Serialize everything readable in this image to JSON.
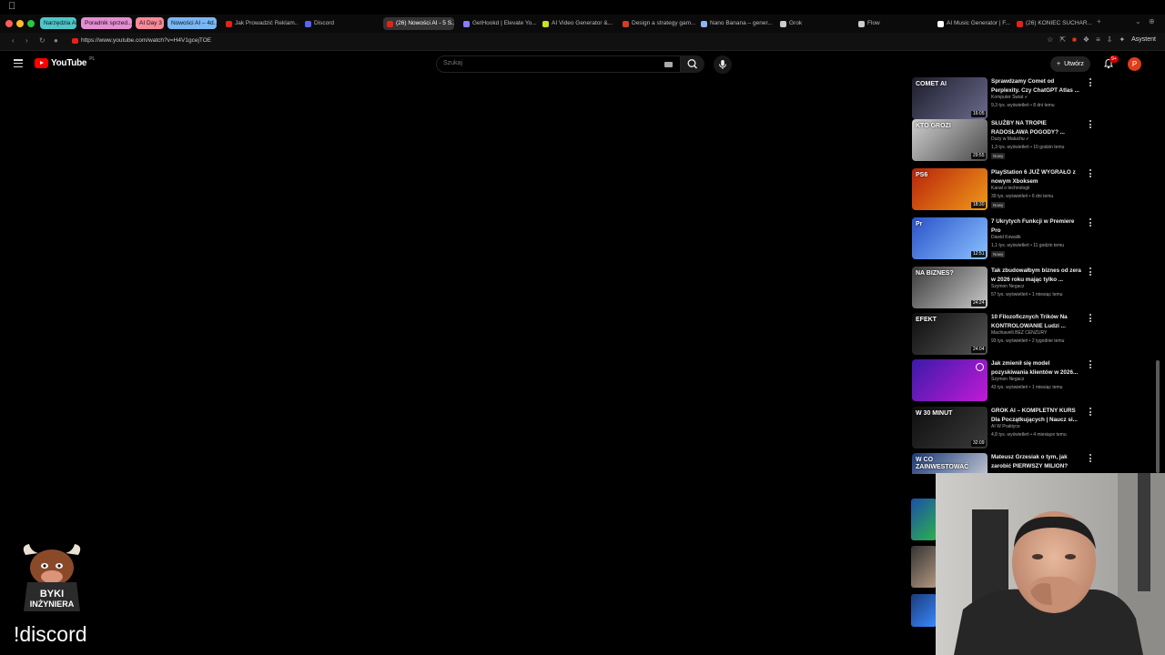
{
  "browser": {
    "tab_groups": [
      {
        "label": "Narzędzia AI",
        "color": "#4fc6c9"
      },
      {
        "label": "Poradnik sprzed...",
        "color": "#e58ed3"
      },
      {
        "label": "AI Day 3",
        "color": "#f6899a"
      },
      {
        "label": "Nowości AI – 4d...",
        "color": "#79b7f5"
      }
    ],
    "tabs": [
      {
        "label": "Jak Prowadzić Reklam...",
        "favicon_color": "#e62117",
        "active": false
      },
      {
        "label": "Discord",
        "favicon_color": "#5865f2",
        "active": false
      },
      {
        "label": "(26) Nowości AI - 5 S...",
        "favicon_color": "#e62117",
        "active": true
      },
      {
        "label": "GetHookd | Elevate Yo...",
        "favicon_color": "#8a7cff",
        "active": false
      },
      {
        "label": "AI Video Generator &...",
        "favicon_color": "#c8e020",
        "active": false
      },
      {
        "label": "Design a strategy gam...",
        "favicon_color": "#d23c2a",
        "active": false
      },
      {
        "label": "Nano Banana – gener...",
        "favicon_color": "#8ab4f8",
        "active": false
      },
      {
        "label": "Grok",
        "favicon_color": "#cccccc",
        "active": false
      },
      {
        "label": "Flow",
        "favicon_color": "#cccccc",
        "active": false
      },
      {
        "label": "AI Music Generator | F...",
        "favicon_color": "#ffffff",
        "active": false
      },
      {
        "label": "(26) KONIEC SUCHAR...",
        "favicon_color": "#e62117",
        "active": false
      }
    ],
    "new_tab_symbol": "+",
    "url": "https://www.youtube.com/watch?v=H4V1gcejTOE",
    "assistant_label": "Asystent"
  },
  "youtube": {
    "logo_text": "YouTube",
    "region": "PL",
    "search_placeholder": "Szukaj",
    "create_label": "Utwórz",
    "notif_badge": "9+",
    "avatar_letter": "P"
  },
  "videos": [
    {
      "title": "Sprawdzamy Comet od Perplexity. Czy ChatGPT Atlas ...",
      "channel": "Komputer Świat",
      "verified": true,
      "meta": "9,3 tys. wyświetleń • 8 dni temu",
      "duration": "16:05",
      "is_new": false,
      "thumb_colors": [
        "#1d1d2c",
        "#6a6a8c"
      ],
      "thumb_text": "COMET AI"
    },
    {
      "title": "SŁUŻBY NA TROPIE RADOSŁAWA POGODY? ...",
      "channel": "Duży w Maluchu",
      "verified": true,
      "meta": "1,3 tys. wyświetleń • 10 godzin temu",
      "duration": "29:55",
      "is_new": true,
      "thumb_colors": [
        "#cfcfcf",
        "#4a4a4a"
      ],
      "thumb_text": "KTO GROZI"
    },
    {
      "title": "PlayStation 6 JUŻ WYGRAŁO z nowym Xboksem",
      "channel": "Kanał o technologii",
      "verified": false,
      "meta": "39 tys. wyświetleń • 6 dni temu",
      "duration": "18:30",
      "is_new": true,
      "thumb_colors": [
        "#b9230b",
        "#f09a1a"
      ],
      "thumb_text": "PS6"
    },
    {
      "title": "7 Ukrytych Funkcji w Premiere Pro",
      "channel": "Dawid Kowalik",
      "verified": false,
      "meta": "1,1 tys. wyświetleń • 11 godzin temu",
      "duration": "12:51",
      "is_new": true,
      "thumb_colors": [
        "#2a52c9",
        "#8ac2ff"
      ],
      "thumb_text": "Pr"
    },
    {
      "title": "Tak zbudowałbym biznes od zera w 2026 roku mając tylko ...",
      "channel": "Szymon Negacz",
      "verified": false,
      "meta": "57 tys. wyświetleń • 1 miesiąc temu",
      "duration": "24:24",
      "is_new": false,
      "thumb_colors": [
        "#3b3b3b",
        "#c9c9c9"
      ],
      "thumb_text": "NA BIZNES?"
    },
    {
      "title": "10 Filozoficznych Trików Na KONTROLOWANIE Ludzi ...",
      "channel": "Machiavelli BEZ CENZURY",
      "verified": false,
      "meta": "93 tys. wyświetleń • 2 tygodnie temu",
      "duration": "24:04",
      "is_new": false,
      "thumb_colors": [
        "#0d0d0d",
        "#555555"
      ],
      "thumb_text": "EFEKT"
    },
    {
      "title": "Jak zmienił się model pozyskiwania klientów w 2026...",
      "channel": "Szymon Negacz",
      "verified": false,
      "meta": "43 tys. wyświetleń • 1 miesiąc temu",
      "duration": "",
      "is_new": false,
      "thumb_colors": [
        "#3a1aa8",
        "#c21ad6"
      ],
      "thumb_text": ""
    },
    {
      "title": "GROK AI – KOMPLETNY KURS Dla Początkujących | Naucz si...",
      "channel": "AI W Praktyce",
      "verified": false,
      "meta": "4,8 tys. wyświetleń • 4 miesiące temu",
      "duration": "32:09",
      "is_new": false,
      "thumb_colors": [
        "#0e0e0e",
        "#3a3a3a"
      ],
      "thumb_text": "W 30 MINUT"
    },
    {
      "title": "Mateusz Grzesiak o tym, jak zarobić PIERWSZY MILION?",
      "channel": "",
      "verified": false,
      "meta": "",
      "duration": "",
      "is_new": false,
      "thumb_colors": [
        "#1a3a7a",
        "#e0e0e0"
      ],
      "thumb_text": "W CO ZAINWESTOWAĆ"
    }
  ],
  "labels": {
    "new_badge": "Nowy"
  },
  "overlay": {
    "logo_lines": [
      "BYKI",
      "INŻYNIERA"
    ],
    "discord_text": "!discord"
  }
}
